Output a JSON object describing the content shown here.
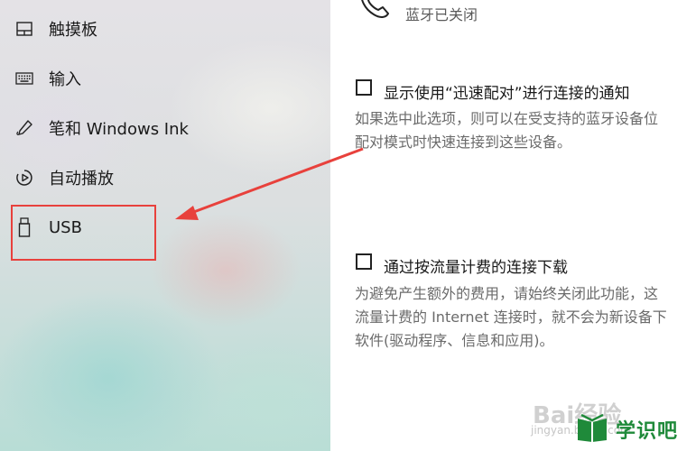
{
  "sidebar": {
    "items": [
      {
        "label": "触摸板",
        "icon": "touchpad-icon"
      },
      {
        "label": "输入",
        "icon": "keyboard-icon"
      },
      {
        "label": "笔和 Windows Ink",
        "icon": "pen-icon"
      },
      {
        "label": "自动播放",
        "icon": "autoplay-icon"
      },
      {
        "label": "USB",
        "icon": "usb-icon"
      }
    ],
    "highlighted_item": "USB"
  },
  "content": {
    "bluetooth_status": "蓝牙已关闭",
    "swift_pair": {
      "label": "显示使用“迅速配对”进行连接的通知",
      "checked": false,
      "description": [
        "如果选中此选项，则可以在受支持的蓝牙设备位",
        "配对模式时快速连接到这些设备。"
      ]
    },
    "metered": {
      "label": "通过按流量计费的连接下载",
      "checked": false,
      "description": [
        "为避免产生额外的费用，请始终关闭此功能，这",
        "流量计费的 Internet 连接时，就不会为新设备下",
        "软件(驱动程序、信息和应用)。"
      ]
    }
  },
  "watermark": {
    "baidu": "Bai经验",
    "jingyan": "jingyan.baidu.com",
    "logo_text": "学识吧",
    "accent_color": "#1f8a3a"
  },
  "colors": {
    "highlight": "#e8413c",
    "arrow": "#e8413c"
  }
}
